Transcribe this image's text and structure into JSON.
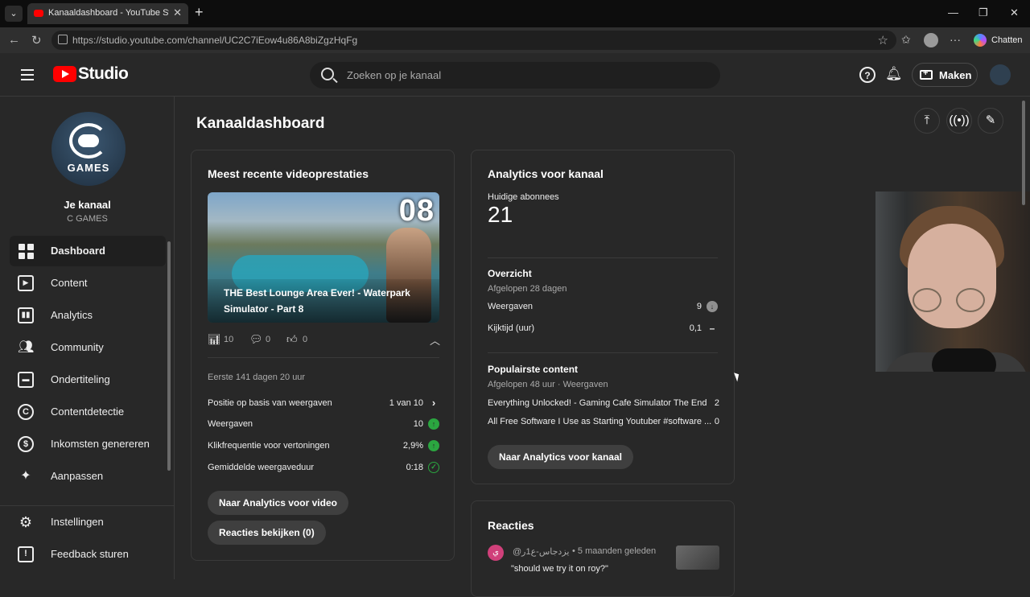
{
  "browser": {
    "tab_title": "Kanaaldashboard - YouTube Studio",
    "url": "https://studio.youtube.com/channel/UC2C7iEow4u86A8biZgzHqFg",
    "chatten": "Chatten"
  },
  "header": {
    "logo_text": "Studio",
    "search_placeholder": "Zoeken op je kanaal",
    "create_label": "Maken"
  },
  "sidebar": {
    "channel_avatar_text": "GAMES",
    "channel_title": "Je kanaal",
    "channel_name": "C GAMES",
    "items": [
      {
        "label": "Dashboard",
        "icon": "dashboard-icon",
        "active": true
      },
      {
        "label": "Content",
        "icon": "content-icon"
      },
      {
        "label": "Analytics",
        "icon": "analytics-icon"
      },
      {
        "label": "Community",
        "icon": "community-icon"
      },
      {
        "label": "Ondertiteling",
        "icon": "subtitles-icon"
      },
      {
        "label": "Contentdetectie",
        "icon": "copyright-icon"
      },
      {
        "label": "Inkomsten genereren",
        "icon": "monetization-icon"
      },
      {
        "label": "Aanpassen",
        "icon": "customize-icon"
      }
    ],
    "bottom_items": [
      {
        "label": "Instellingen",
        "icon": "settings-icon"
      },
      {
        "label": "Feedback sturen",
        "icon": "feedback-icon"
      }
    ]
  },
  "main": {
    "page_title": "Kanaaldashboard",
    "video_card": {
      "title": "Meest recente videoprestaties",
      "thumb_number": "08",
      "video_title": "THE Best Lounge Area Ever! - Waterpark Simulator - Part 8",
      "views": "10",
      "comments": "0",
      "likes": "0",
      "period": "Eerste 141 dagen 20 uur",
      "metrics": [
        {
          "label": "Positie op basis van weergaven",
          "value": "1 van 10",
          "indicator": "arrow"
        },
        {
          "label": "Weergaven",
          "value": "10",
          "indicator": "up"
        },
        {
          "label": "Klikfrequentie voor vertoningen",
          "value": "2,9%",
          "indicator": "up"
        },
        {
          "label": "Gemiddelde weergaveduur",
          "value": "0:18",
          "indicator": "check"
        }
      ],
      "analytics_button": "Naar Analytics voor video",
      "comments_button": "Reacties bekijken (0)"
    },
    "analytics_card": {
      "title": "Analytics voor kanaal",
      "subscribers_label": "Huidige abonnees",
      "subscribers": "21",
      "overview_title": "Overzicht",
      "overview_period": "Afgelopen 28 dagen",
      "overview_rows": [
        {
          "label": "Weergaven",
          "value": "9",
          "indicator": "down"
        },
        {
          "label": "Kijktijd (uur)",
          "value": "0,1",
          "indicator": "dash"
        }
      ],
      "popular_title": "Populairste content",
      "popular_period": "Afgelopen 48 uur · Weergaven",
      "popular_rows": [
        {
          "label": "Everything Unlocked! - Gaming Cafe Simulator The End",
          "value": "2"
        },
        {
          "label": "All Free Software I Use as Starting Youtuber #software ...",
          "value": "0"
        }
      ],
      "button": "Naar Analytics voor kanaal"
    },
    "comments_card": {
      "title": "Reacties",
      "author": "@يزدجاس-ع1ر",
      "avatar_letter": "ي",
      "time": "• 5 maanden geleden",
      "text": "\"should we try it on roy?\""
    }
  },
  "colors": {
    "youtube_red": "#ff0000",
    "positive_green": "#2ba640",
    "background": "#282828"
  }
}
